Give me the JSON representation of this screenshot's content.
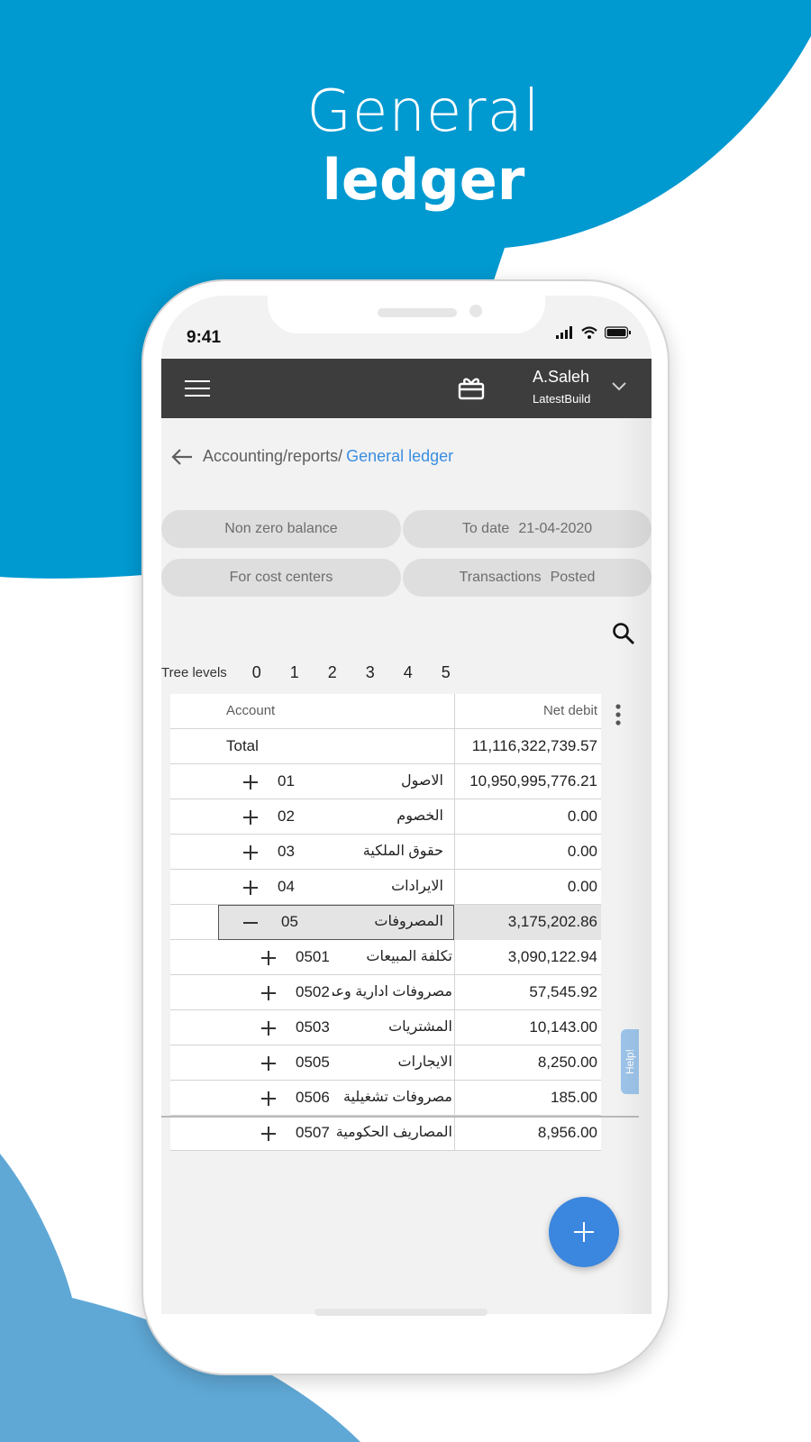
{
  "hero": {
    "line1": "General",
    "line2": "ledger"
  },
  "colors": {
    "background_blue": "#0099d0",
    "light_blue": "#5fa8d6",
    "appbar": "#3d3d3d",
    "accent": "#3b8ee0",
    "fab": "#3b86de"
  },
  "status": {
    "time": "9:41"
  },
  "appbar": {
    "user_name": "A.Saleh",
    "user_build": "LatestBuild"
  },
  "breadcrumb": {
    "path": "Accounting/reports/",
    "current": "General ledger"
  },
  "chips": [
    {
      "label": "Non zero balance",
      "value": ""
    },
    {
      "label": "To date",
      "value": "21-04-2020"
    },
    {
      "label": "For cost centers",
      "value": ""
    },
    {
      "label": "Transactions",
      "value": "Posted"
    }
  ],
  "tree": {
    "label": "Tree levels",
    "levels": [
      "0",
      "1",
      "2",
      "3",
      "4",
      "5"
    ]
  },
  "table": {
    "columns": {
      "account": "Account",
      "net_debit": "Net debit"
    },
    "total": {
      "label": "Total",
      "value": "11,116,322,739.57"
    },
    "rows": [
      {
        "code": "01",
        "name": "الاصول",
        "value": "10,950,995,776.21",
        "depth": 1,
        "expanded": false
      },
      {
        "code": "02",
        "name": "الخصوم",
        "value": "0.00",
        "depth": 1,
        "expanded": false
      },
      {
        "code": "03",
        "name": "حقوق الملكية",
        "value": "0.00",
        "depth": 1,
        "expanded": false
      },
      {
        "code": "04",
        "name": "الايرادات",
        "value": "0.00",
        "depth": 1,
        "expanded": false
      },
      {
        "code": "05",
        "name": "المصروفات",
        "value": "3,175,202.86",
        "depth": 1,
        "expanded": true
      },
      {
        "code": "0501",
        "name": "تكلفة المبيعات",
        "value": "3,090,122.94",
        "depth": 2,
        "expanded": false
      },
      {
        "code": "0502",
        "name": "مصروفات ادارية وعمومية",
        "value": "57,545.92",
        "depth": 2,
        "expanded": false
      },
      {
        "code": "0503",
        "name": "المشتريات",
        "value": "10,143.00",
        "depth": 2,
        "expanded": false
      },
      {
        "code": "0505",
        "name": "الايجارات",
        "value": "8,250.00",
        "depth": 2,
        "expanded": false
      },
      {
        "code": "0506",
        "name": "مصروفات تشغيلية",
        "value": "185.00",
        "depth": 2,
        "expanded": false
      },
      {
        "code": "0507",
        "name": "المصاريف الحكومية",
        "value": "8,956.00",
        "depth": 2,
        "expanded": false
      }
    ]
  },
  "help": {
    "label": "Help!"
  },
  "icons": [
    "menu-icon",
    "gift-icon",
    "chevron-down-icon",
    "back-arrow-icon",
    "search-icon",
    "more-vertical-icon",
    "plus-icon",
    "minus-icon",
    "signal-icon",
    "wifi-icon",
    "battery-icon"
  ]
}
